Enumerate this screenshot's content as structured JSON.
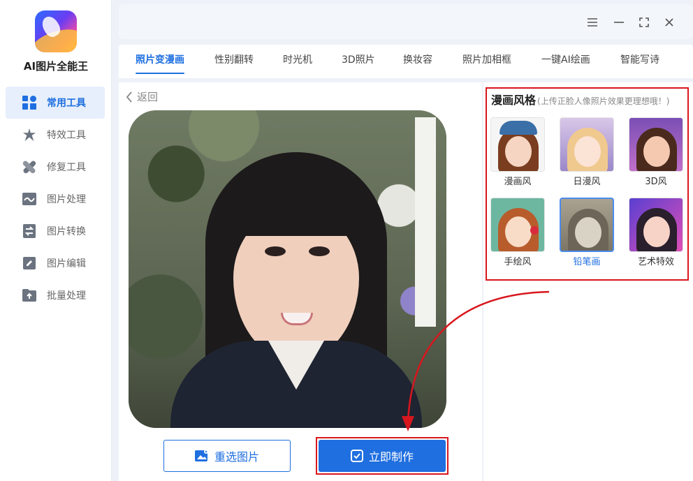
{
  "app": {
    "title": "AI图片全能王"
  },
  "sidebar": {
    "items": [
      {
        "label": "常用工具",
        "icon": "grid-icon",
        "active": true
      },
      {
        "label": "特效工具",
        "icon": "star-burst-icon",
        "active": false
      },
      {
        "label": "修复工具",
        "icon": "bandage-icon",
        "active": false
      },
      {
        "label": "图片处理",
        "icon": "image-wave-icon",
        "active": false
      },
      {
        "label": "图片转换",
        "icon": "convert-icon",
        "active": false
      },
      {
        "label": "图片编辑",
        "icon": "edit-image-icon",
        "active": false
      },
      {
        "label": "批量处理",
        "icon": "upload-folder-icon",
        "active": false
      }
    ]
  },
  "window": {
    "controls": [
      "menu-icon",
      "minimize-icon",
      "maximize-icon",
      "close-icon"
    ]
  },
  "tabs": [
    {
      "label": "照片变漫画",
      "active": true
    },
    {
      "label": "性别翻转",
      "active": false
    },
    {
      "label": "时光机",
      "active": false
    },
    {
      "label": "3D照片",
      "active": false
    },
    {
      "label": "换妆容",
      "active": false
    },
    {
      "label": "照片加相框",
      "active": false
    },
    {
      "label": "一键AI绘画",
      "active": false
    },
    {
      "label": "智能写诗",
      "active": false
    }
  ],
  "main": {
    "back_label": "返回",
    "reselect_label": "重选图片",
    "create_label": "立即制作"
  },
  "style_panel": {
    "title": "漫画风格",
    "hint": "(上传正脸人像照片效果更理想哦！)",
    "styles": [
      {
        "label": "漫画风",
        "selected": false
      },
      {
        "label": "日漫风",
        "selected": false
      },
      {
        "label": "3D风",
        "selected": false
      },
      {
        "label": "手绘风",
        "selected": false
      },
      {
        "label": "铅笔画",
        "selected": true
      },
      {
        "label": "艺术特效",
        "selected": false
      }
    ]
  },
  "colors": {
    "accent": "#1f6fe0",
    "highlight": "#d8161d"
  }
}
